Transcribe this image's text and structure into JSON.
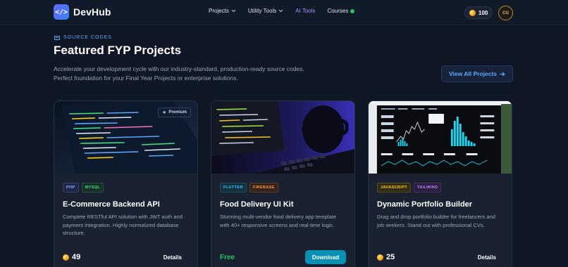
{
  "brand": {
    "logo_glyph": "</>",
    "name": "DevHub"
  },
  "nav": {
    "links": [
      {
        "label": "Projects",
        "has_dropdown": true
      },
      {
        "label": "Utility Tools",
        "has_dropdown": true
      },
      {
        "label": "AI Tools",
        "has_dropdown": false
      },
      {
        "label": "Courses",
        "has_dropdown": false,
        "status_dot": "green"
      }
    ],
    "coin_balance": "100",
    "avatar_text": "CG"
  },
  "hero": {
    "eyebrow": "SOURCE CODES",
    "title": "Featured FYP Projects",
    "description": "Accelerate your development cycle with our industry-standard, production-ready source codes. Perfect foundation for your Final Year Projects or enterprise solutions.",
    "view_all_label": "View All Projects",
    "view_all_icon": "arrow-right-icon"
  },
  "cards": [
    {
      "badge": "Premium",
      "tags": [
        "PHP",
        "MYSQL"
      ],
      "title": "E-Commerce Backend API",
      "description": "Complete RESTful API solution with JWT auth and payment integration. Highly normalized database structure.",
      "price": "49",
      "action": "Details"
    },
    {
      "tags": [
        "FLUTTER",
        "FIREBASE"
      ],
      "title": "Food Delivery UI Kit",
      "description": "Stunning multi-vendor food delivery app template with 40+ responsive screens and real-time logic.",
      "price": "Free",
      "action": "Download"
    },
    {
      "tags": [
        "JAVASCRIPT",
        "TAILWIND"
      ],
      "title": "Dynamic Portfolio Builder",
      "description": "Drag and drop portfolio builder for freelancers and job seekers. Stand out with professional CVs.",
      "price": "25",
      "action": "Details"
    }
  ],
  "colors": {
    "background": "#0f1624",
    "card": "#1a2232",
    "accent_blue": "#60a5fa",
    "ai_tools": "#a78bfa",
    "free_green": "#22c55e",
    "download_button": "#0891b2"
  }
}
